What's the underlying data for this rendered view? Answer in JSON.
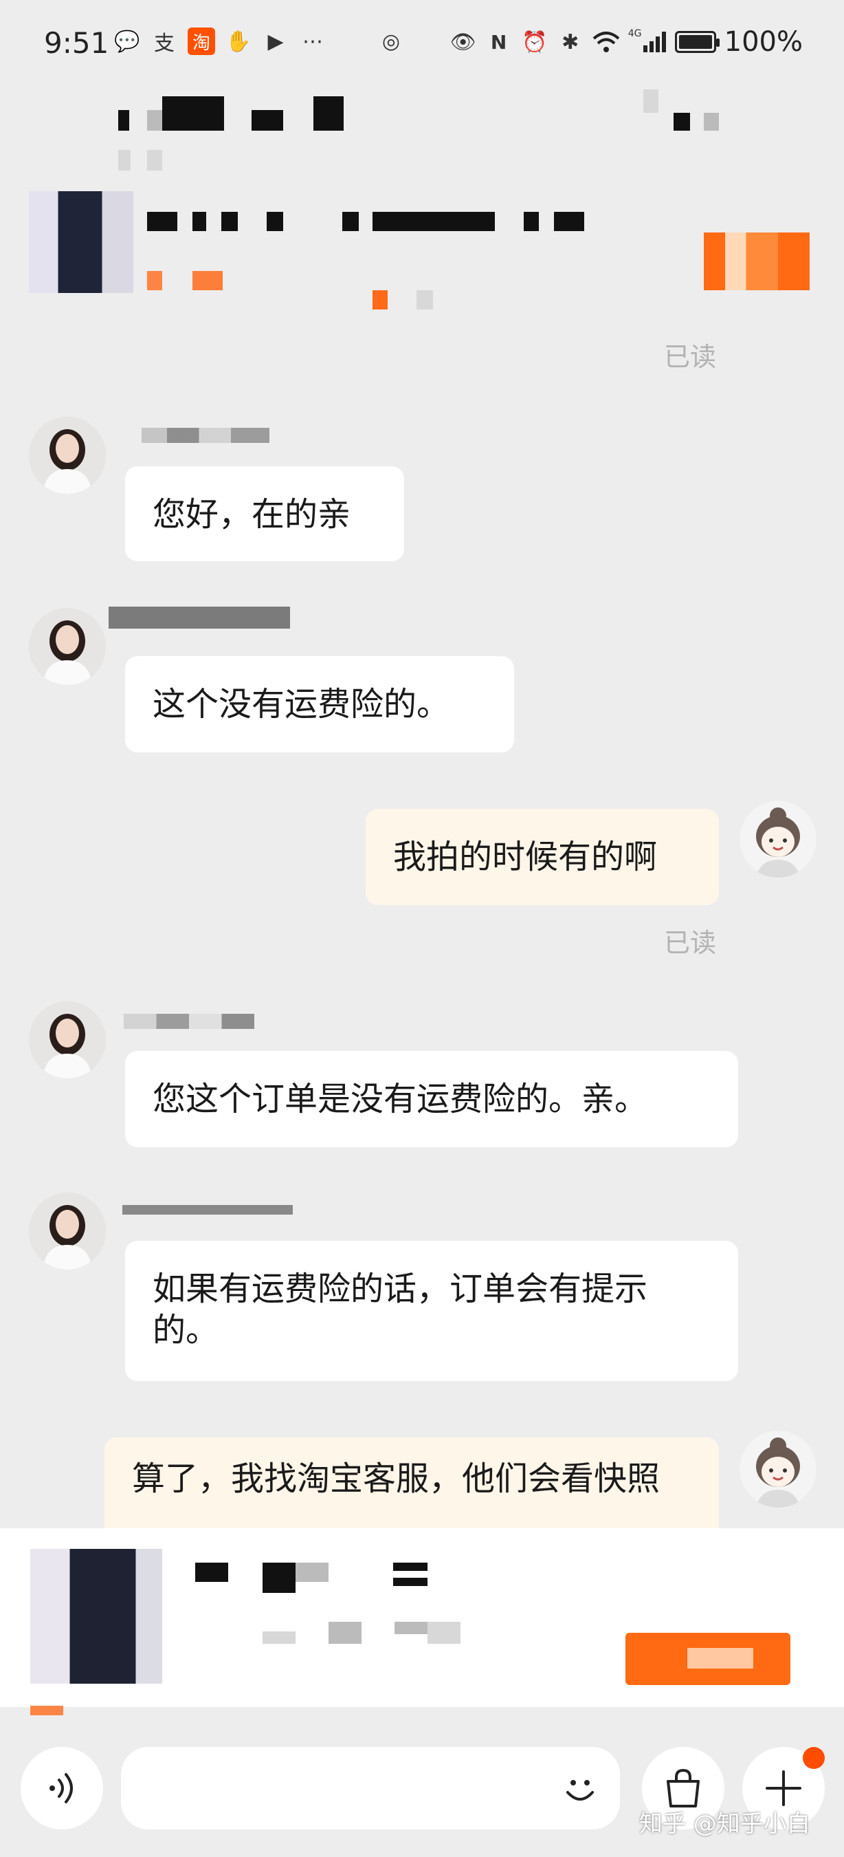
{
  "status_bar": {
    "time": "9:51",
    "left_icons": [
      "message-bubble-icon",
      "alipay-icon",
      "taobao-icon",
      "hand-icon",
      "play-icon",
      "more-dots-icon",
      "app-icon"
    ],
    "right_icons": [
      "eye-icon",
      "nfc-icon",
      "alarm-icon",
      "bluetooth-icon",
      "wifi-icon",
      "signal-icon"
    ],
    "network": "4G",
    "battery": "100%",
    "battery_level": 1.0
  },
  "chat": {
    "read_label_1": "已读",
    "read_label_2": "已读",
    "messages": [
      {
        "from": "agent",
        "text": "您好，在的亲"
      },
      {
        "from": "agent",
        "text": "这个没有运费险的。"
      },
      {
        "from": "me",
        "text": "我拍的时候有的啊"
      },
      {
        "from": "agent",
        "text": "您这个订单是没有运费险的。亲。"
      },
      {
        "from": "agent",
        "text": "如果有运费险的话，订单会有提示的。"
      },
      {
        "from": "me",
        "text": "算了，我找淘宝客服，他们会看快照"
      }
    ]
  },
  "bottom_bar": {
    "icons": [
      "voice-icon",
      "emoji-icon",
      "shopping-bag-icon",
      "plus-icon"
    ]
  },
  "watermark": "知乎 @知乎小白",
  "colors": {
    "background": "#ededed",
    "agent_bubble": "#ffffff",
    "my_bubble": "#fff6ea",
    "accent": "#ff6a12",
    "read_label": "#b3b3b3"
  }
}
